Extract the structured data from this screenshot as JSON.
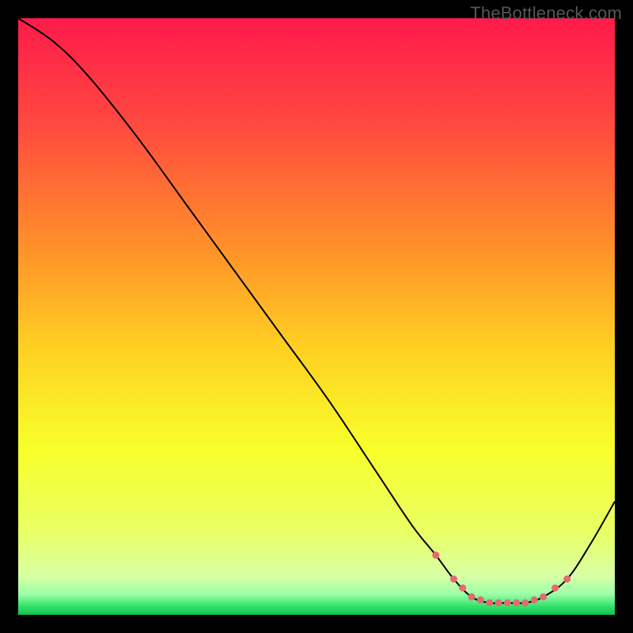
{
  "watermark": "TheBottleneck.com",
  "colors": {
    "marker": "#e46a6f",
    "curve": "#000000",
    "frame": "#000000"
  },
  "gradient_stops": [
    {
      "offset": 0.0,
      "color": "#ff1a4b"
    },
    {
      "offset": 0.18,
      "color": "#ff4a3f"
    },
    {
      "offset": 0.38,
      "color": "#ff8f2a"
    },
    {
      "offset": 0.55,
      "color": "#ffcf22"
    },
    {
      "offset": 0.72,
      "color": "#f8ff2a"
    },
    {
      "offset": 0.86,
      "color": "#eaff63"
    },
    {
      "offset": 0.935,
      "color": "#d8ffa6"
    },
    {
      "offset": 0.965,
      "color": "#9effa8"
    },
    {
      "offset": 0.985,
      "color": "#35e36c"
    },
    {
      "offset": 1.0,
      "color": "#11c24f"
    }
  ],
  "chart_data": {
    "type": "line",
    "title": "",
    "xlabel": "",
    "ylabel": "",
    "xlim": [
      0,
      100
    ],
    "ylim": [
      0,
      100
    ],
    "grid": false,
    "series": [
      {
        "name": "bottleneck-curve",
        "x": [
          0,
          6,
          12,
          20,
          28,
          36,
          44,
          52,
          60,
          66,
          70,
          73,
          76,
          79,
          82,
          85,
          88,
          92,
          96,
          100
        ],
        "y": [
          100,
          96,
          90,
          80,
          69,
          58,
          47,
          36,
          24,
          15,
          10,
          6,
          3,
          2,
          2,
          2,
          3,
          6,
          12,
          19
        ]
      }
    ],
    "markers": {
      "series": "bottleneck-curve",
      "x": [
        70,
        73,
        74.5,
        76,
        77.5,
        79,
        80.5,
        82,
        83.5,
        85,
        86.5,
        88,
        90,
        92
      ],
      "y": [
        10,
        6,
        4.5,
        3,
        2.5,
        2,
        2,
        2,
        2,
        2,
        2.5,
        3,
        4.5,
        6
      ],
      "r": 4.5
    }
  }
}
